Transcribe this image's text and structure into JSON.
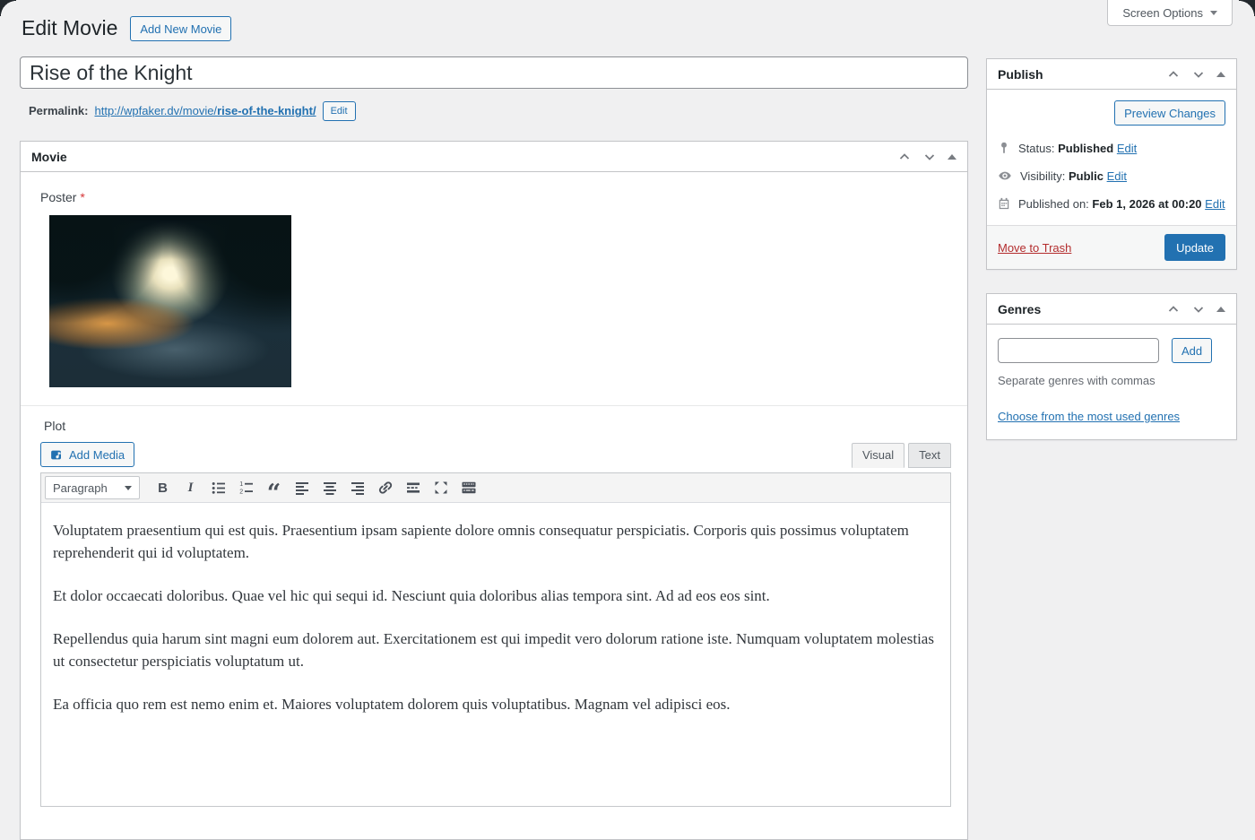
{
  "colors": {
    "accent": "#2271b1",
    "primary_button": "#2271b1",
    "danger": "#b32d2e",
    "background": "#f0f0f1"
  },
  "screen_options": {
    "label": "Screen Options"
  },
  "header": {
    "title": "Edit Movie",
    "add_new_button": "Add New Movie"
  },
  "title_field": {
    "value": "Rise of the Knight"
  },
  "permalink": {
    "label": "Permalink:",
    "url_base": "http://wpfaker.dv/movie/",
    "slug": "rise-of-the-knight/",
    "edit_button": "Edit"
  },
  "movie_box": {
    "title": "Movie",
    "poster_label": "Poster",
    "required_mark": "*",
    "plot_label": "Plot",
    "add_media_button": "Add Media",
    "editor_tabs": {
      "visual": "Visual",
      "text": "Text"
    },
    "toolbar": {
      "block_format": "Paragraph",
      "tools": [
        "bold",
        "italic",
        "bulleted-list",
        "numbered-list",
        "blockquote",
        "align-left",
        "align-center",
        "align-right",
        "link",
        "read-more",
        "fullscreen",
        "toolbar-toggle"
      ]
    },
    "plot_paragraphs": [
      "Voluptatem praesentium qui est quis. Praesentium ipsam sapiente dolore omnis consequatur perspiciatis. Corporis quis possimus voluptatem reprehenderit qui id voluptatem.",
      "Et dolor occaecati doloribus. Quae vel hic qui sequi id. Nesciunt quia doloribus alias tempora sint. Ad ad eos eos sint.",
      "Repellendus quia harum sint magni eum dolorem aut. Exercitationem est qui impedit vero dolorum ratione iste. Numquam voluptatem molestias ut consectetur perspiciatis voluptatum ut.",
      "Ea officia quo rem est nemo enim et. Maiores voluptatem dolorem quis voluptatibus. Magnam vel adipisci eos."
    ]
  },
  "publish_box": {
    "title": "Publish",
    "preview_button": "Preview Changes",
    "status_label": "Status:",
    "status_value": "Published",
    "status_edit": "Edit",
    "visibility_label": "Visibility:",
    "visibility_value": "Public",
    "visibility_edit": "Edit",
    "published_label": "Published on:",
    "published_value": "Feb 1, 2026 at 00:20",
    "published_edit": "Edit",
    "trash_link": "Move to Trash",
    "update_button": "Update"
  },
  "genres_box": {
    "title": "Genres",
    "add_button": "Add",
    "input_value": "",
    "help_text": "Separate genres with commas",
    "most_used_link": "Choose from the most used genres"
  },
  "icons": {
    "status": "pin",
    "visibility": "eye",
    "published": "calendar",
    "add_media": "media-note",
    "screen_options_caret": "triangle-down",
    "box_controls": [
      "chevron-up",
      "chevron-down",
      "toggle-triangle"
    ]
  }
}
